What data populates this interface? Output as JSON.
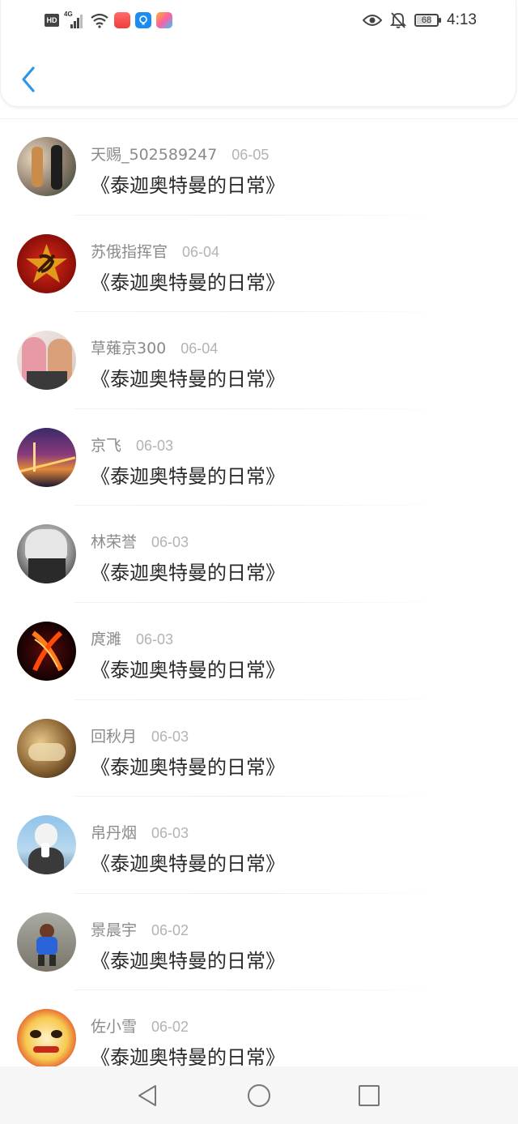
{
  "status_bar": {
    "left_badge": "HD",
    "network": "4G",
    "battery": "68",
    "battery_percent": 68,
    "time": "4:13",
    "icons": [
      "eye-icon",
      "bell-off-icon",
      "battery-icon"
    ]
  },
  "header": {
    "back_icon": "chevron-left-icon",
    "accent_color": "#2b97e6"
  },
  "list": {
    "items": [
      {
        "username": "天赐_502589247",
        "date": "06-05",
        "title": "《泰迦奥特曼的日常》"
      },
      {
        "username": "苏俄指挥官",
        "date": "06-04",
        "title": "《泰迦奥特曼的日常》"
      },
      {
        "username": "草薙京300",
        "date": "06-04",
        "title": "《泰迦奥特曼的日常》"
      },
      {
        "username": "京飞",
        "date": "06-03",
        "title": "《泰迦奥特曼的日常》"
      },
      {
        "username": "林荣誉",
        "date": "06-03",
        "title": "《泰迦奥特曼的日常》"
      },
      {
        "username": "庹濉",
        "date": "06-03",
        "title": "《泰迦奥特曼的日常》"
      },
      {
        "username": "回秋月",
        "date": "06-03",
        "title": "《泰迦奥特曼的日常》"
      },
      {
        "username": "帛丹烟",
        "date": "06-03",
        "title": "《泰迦奥特曼的日常》"
      },
      {
        "username": "景晨宇",
        "date": "06-02",
        "title": "《泰迦奥特曼的日常》"
      },
      {
        "username": "佐小雪",
        "date": "06-02",
        "title": "《泰迦奥特曼的日常》"
      }
    ]
  },
  "nav_bar": {
    "buttons": [
      "back-triangle-icon",
      "home-circle-icon",
      "recents-square-icon"
    ]
  }
}
